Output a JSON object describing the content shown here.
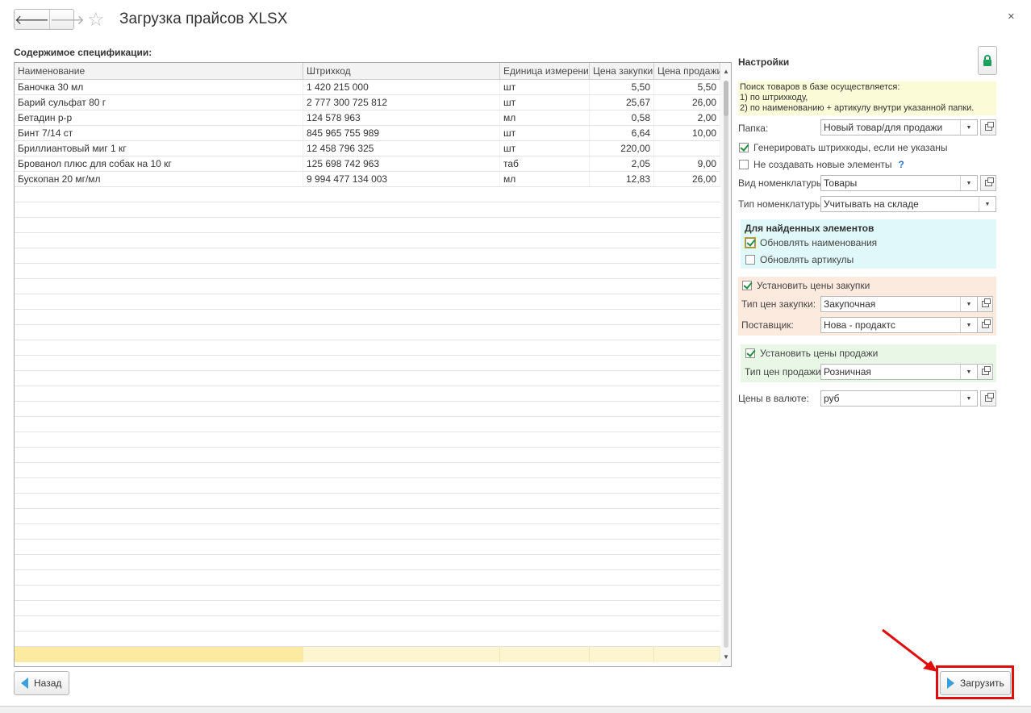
{
  "window": {
    "title": "Загрузка прайсов XLSX",
    "back_icon": "arrow-left-icon",
    "forward_icon": "arrow-right-icon",
    "favorite_icon": "star-icon",
    "close_glyph": "×"
  },
  "spec": {
    "label": "Содержимое спецификации:",
    "columns": [
      "Наименование",
      "Штрихкод",
      "Единица измерения",
      "Цена закупки",
      "Цена продажи"
    ],
    "rows": [
      [
        "Баночка 30 мл",
        "1 420 215 000",
        "шт",
        "5,50",
        "5,50"
      ],
      [
        "Барий сульфат 80 г",
        "2 777 300 725 812",
        "шт",
        "25,67",
        "26,00"
      ],
      [
        "Бетадин р-р",
        "124 578 963",
        "мл",
        "0,58",
        "2,00"
      ],
      [
        "Бинт 7/14 ст",
        "845 965 755 989",
        "шт",
        "6,64",
        "10,00"
      ],
      [
        "Бриллиантовый миг 1 кг",
        "12 458 796 325",
        "шт",
        "220,00",
        ""
      ],
      [
        "Брованол плюс для собак на 10 кг",
        "125 698 742 963",
        "таб",
        "2,05",
        "9,00"
      ],
      [
        "Бускопан 20 мг/мл",
        "9 994 477 134 003",
        "мл",
        "12,83",
        "26,00"
      ]
    ]
  },
  "settings": {
    "title": "Настройки",
    "info_lines": [
      "Поиск товаров в базе осуществляется:",
      "1) по штрихкоду,",
      "2) по наименованию + артикулу внутри указанной папки."
    ],
    "folder_label": "Папка:",
    "folder_value": "Новый товар/для продажи",
    "gen_barcodes_label": "Генерировать штрихкоды, если не указаны",
    "gen_barcodes_checked": true,
    "no_create_label": "Не создавать новые элементы",
    "no_create_checked": false,
    "help_glyph": "?",
    "nom_kind_label": "Вид номенклатуры:",
    "nom_kind_value": "Товары",
    "nom_type_label": "Тип номенклатуры:",
    "nom_type_value": "Учитывать на складе",
    "found_group_title": "Для найденных элементов",
    "update_names_label": "Обновлять наименования",
    "update_names_checked": true,
    "update_articles_label": "Обновлять артикулы",
    "update_articles_checked": false,
    "set_purchase_label": "Установить цены закупки",
    "set_purchase_checked": true,
    "purchase_type_label": "Тип цен закупки:",
    "purchase_type_value": "Закупочная",
    "supplier_label": "Поставщик:",
    "supplier_value": "Нова - продактс",
    "set_sale_label": "Установить цены продажи",
    "set_sale_checked": true,
    "sale_type_label": "Тип цен продажи:",
    "sale_type_value": "Розничная",
    "currency_label": "Цены в валюте:",
    "currency_value": "руб"
  },
  "buttons": {
    "back_label": "Назад",
    "load_label": "Загрузить"
  },
  "colors": {
    "accent_arrow": "#e00d0d",
    "button_arrow": "#3aa0dc",
    "info_bg": "#fbfbd8",
    "found_group_bg": "#e0f8f9",
    "purchase_group_bg": "#fdeadf",
    "sale_group_bg": "#e9f8e6"
  }
}
